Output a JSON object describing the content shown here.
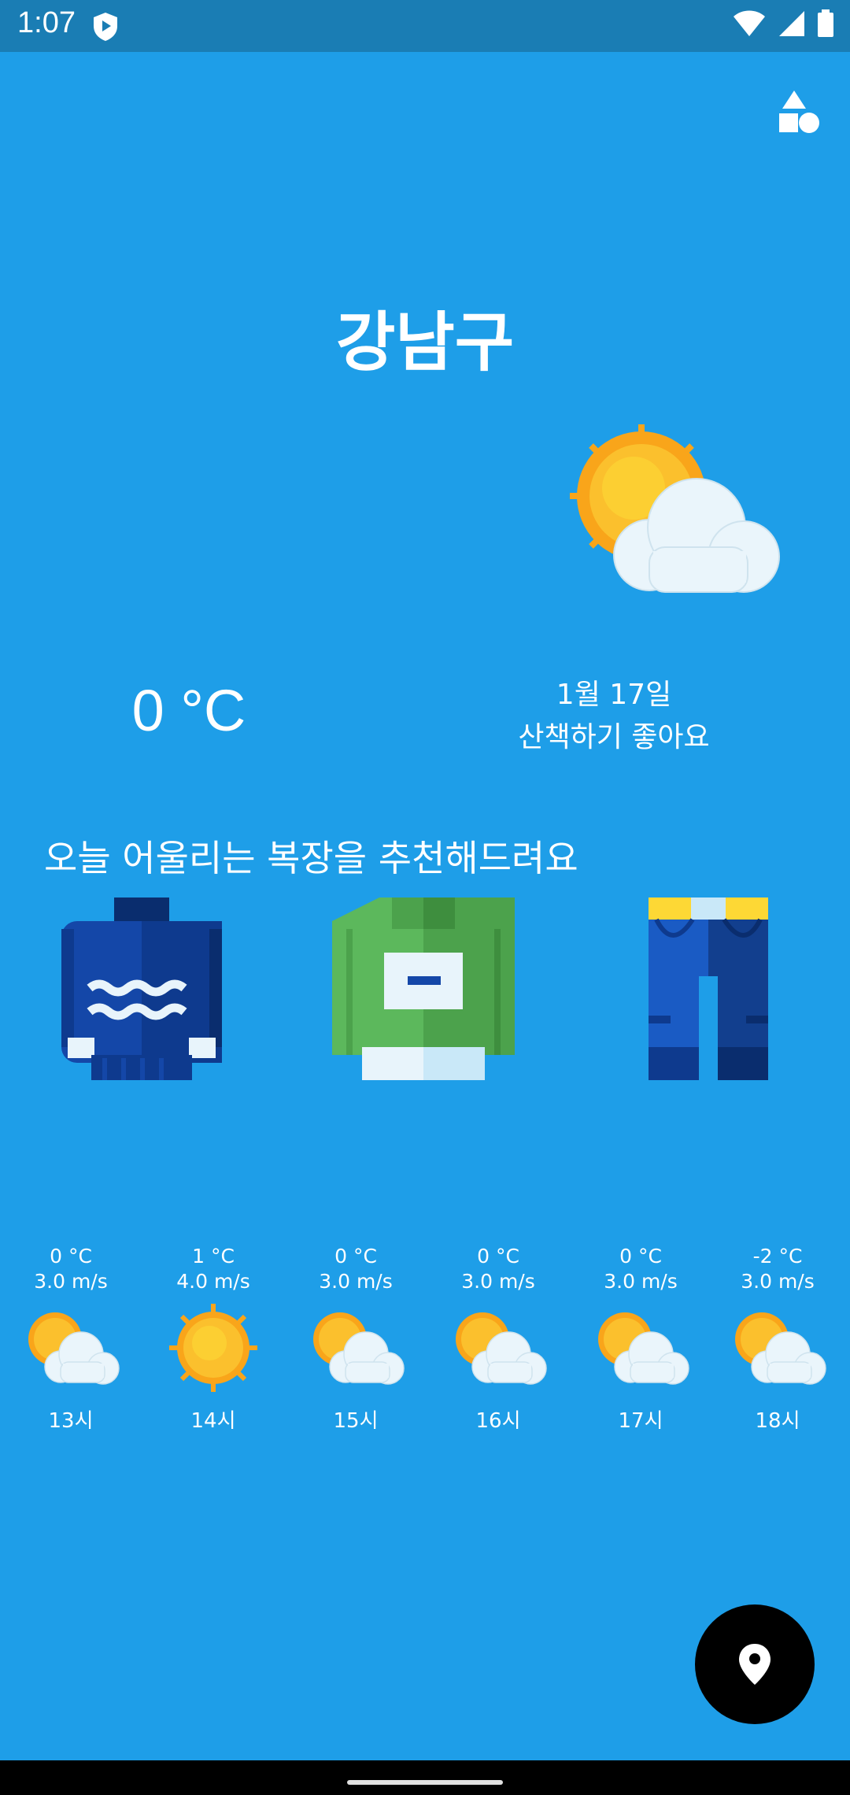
{
  "status_bar": {
    "time": "1:07",
    "icons": [
      "shield-play-icon",
      "wifi-icon",
      "signal-icon",
      "battery-icon"
    ]
  },
  "toolbar": {
    "shapes_icon": "shapes-icon"
  },
  "location": {
    "city": "강남구"
  },
  "current": {
    "temperature": "0 °C",
    "date": "1월 17일",
    "message": "산책하기 좋아요",
    "icon": "partly-cloudy-icon"
  },
  "recommendation": {
    "title": "오늘 어울리는 복장을 추천해드려요",
    "items": [
      {
        "icon": "sweater-icon"
      },
      {
        "icon": "shirt-icon"
      },
      {
        "icon": "jeans-icon"
      }
    ]
  },
  "hourly": [
    {
      "temp": "0 °C",
      "wind": "3.0 m/s",
      "hour": "13시",
      "icon": "partly-cloudy-icon"
    },
    {
      "temp": "1 °C",
      "wind": "4.0 m/s",
      "hour": "14시",
      "icon": "sunny-icon"
    },
    {
      "temp": "0 °C",
      "wind": "3.0 m/s",
      "hour": "15시",
      "icon": "partly-cloudy-icon"
    },
    {
      "temp": "0 °C",
      "wind": "3.0 m/s",
      "hour": "16시",
      "icon": "partly-cloudy-icon"
    },
    {
      "temp": "0 °C",
      "wind": "3.0 m/s",
      "hour": "17시",
      "icon": "partly-cloudy-icon"
    },
    {
      "temp": "-2 °C",
      "wind": "3.0 m/s",
      "hour": "18시",
      "icon": "partly-cloudy-icon"
    }
  ],
  "fab": {
    "icon": "location-pin-icon"
  },
  "colors": {
    "background": "#1E9EE8",
    "status_bar": "#1a7db4",
    "fab": "#000000"
  }
}
